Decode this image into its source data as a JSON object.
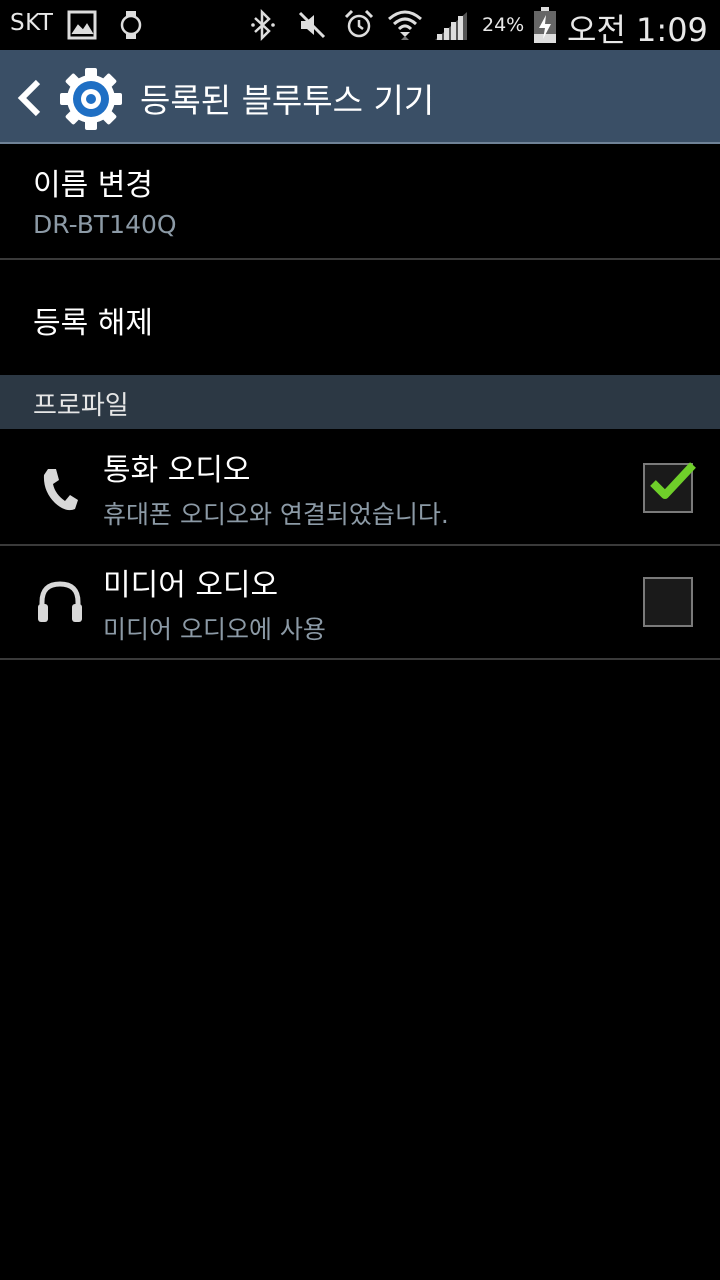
{
  "status_bar": {
    "carrier": "SKT",
    "battery_percent": "24%",
    "time": "오전 1:09"
  },
  "action_bar": {
    "title": "등록된 블루투스 기기"
  },
  "rename": {
    "title": "이름 변경",
    "device_name": "DR-BT140Q"
  },
  "unpair": {
    "title": "등록 해제"
  },
  "profiles": {
    "header": "프로파일",
    "items": [
      {
        "title": "통화 오디오",
        "subtitle": "휴대폰 오디오와 연결되었습니다.",
        "icon": "phone-icon",
        "checked": true
      },
      {
        "title": "미디어 오디오",
        "subtitle": "미디어 오디오에 사용",
        "icon": "headphones-icon",
        "checked": false
      }
    ]
  },
  "colors": {
    "action_bar_bg": "#3a4f66",
    "section_header_bg": "#2c3844",
    "check_green": "#6fcf2a"
  }
}
